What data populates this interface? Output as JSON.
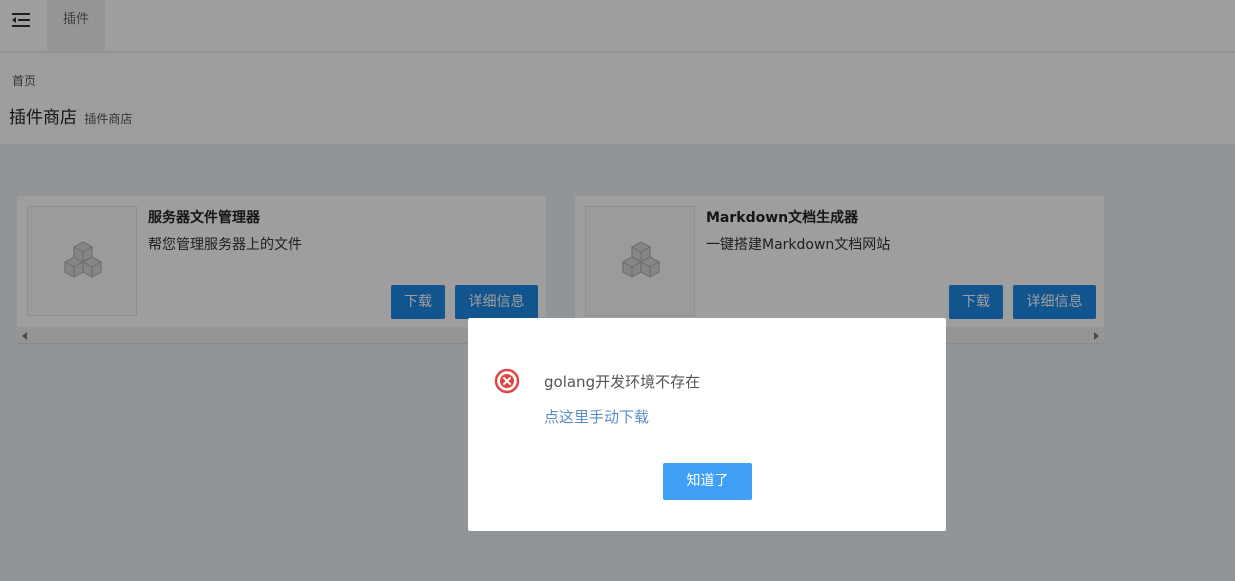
{
  "topbar": {
    "menu_icon": "menu-collapse-icon",
    "tab_label": "插件"
  },
  "header": {
    "breadcrumb": "首页",
    "title": "插件商店",
    "subtitle": "插件商店"
  },
  "plugins": [
    {
      "icon": "cubes-icon",
      "name": "服务器文件管理器",
      "description": "帮您管理服务器上的文件",
      "download_label": "下载",
      "details_label": "详细信息"
    },
    {
      "icon": "cubes-icon",
      "name": "Markdown文档生成器",
      "description": "一键搭建Markdown文档网站",
      "download_label": "下载",
      "details_label": "详细信息"
    }
  ],
  "dialog": {
    "icon": "error-circle-icon",
    "message": "golang开发环境不存在",
    "link_text": "点这里手动下载",
    "confirm_label": "知道了"
  },
  "colors": {
    "primary_button": "#1e88e5",
    "dialog_button": "#3fa0f5",
    "link": "#5a8dc8",
    "error": "#e04545",
    "background": "#ecf0f5"
  }
}
